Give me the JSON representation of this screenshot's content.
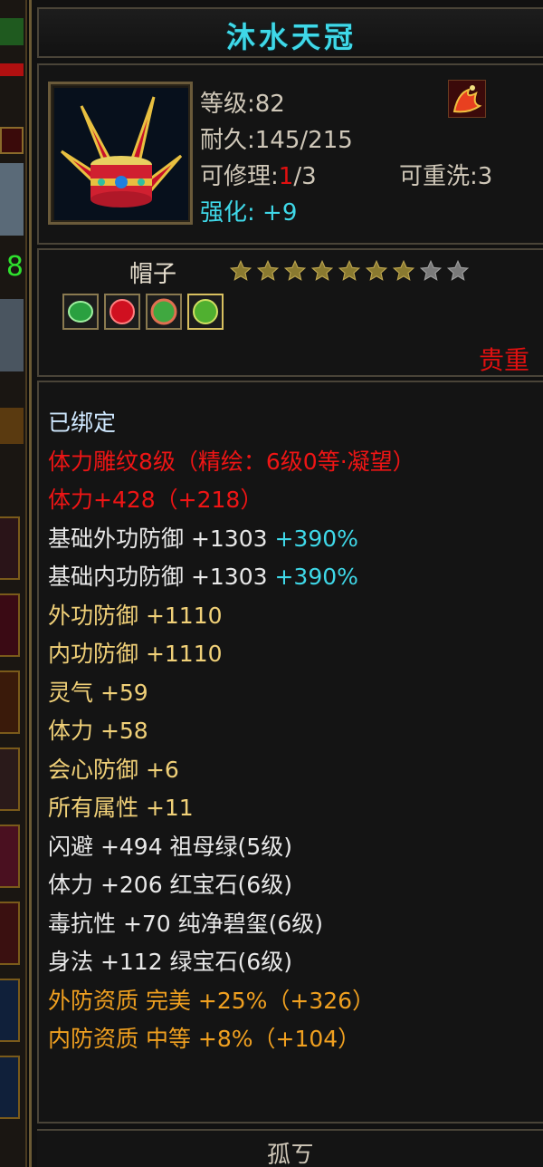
{
  "item": {
    "name": "沐水天冠",
    "level_label": "等级:82",
    "durability_label": "耐久:145/215",
    "repair_prefix": "可修理:",
    "repair_used": "1",
    "repair_max": "/3",
    "rewash_label": "可重洗:3",
    "enhance_label": "强化:",
    "enhance_value": "+9",
    "type": "帽子",
    "stars_filled": 7,
    "stars_total": 9,
    "rarity": "贵重",
    "gems": [
      {
        "icon": "green-jade-gem-icon"
      },
      {
        "icon": "red-ruby-gem-icon"
      },
      {
        "icon": "emerald-gem-icon"
      },
      {
        "icon": "green-gem-icon"
      }
    ]
  },
  "stats": [
    {
      "text": "已绑定",
      "color": "white"
    },
    {
      "text": "体力雕纹8级（精绘：6级0等·凝望）",
      "color": "red"
    },
    {
      "text": "体力+428（+218）",
      "color": "red"
    },
    {
      "text": "基础外功防御 +1303",
      "extra": " +390%",
      "color": "white"
    },
    {
      "text": "基础内功防御 +1303",
      "extra": " +390%",
      "color": "white"
    },
    {
      "text": "外功防御 +1110",
      "color": "yellow"
    },
    {
      "text": "内功防御 +1110",
      "color": "yellow"
    },
    {
      "text": "灵气 +59",
      "color": "yellow"
    },
    {
      "text": "体力 +58",
      "color": "yellow"
    },
    {
      "text": "会心防御 +6",
      "color": "yellow"
    },
    {
      "text": "所有属性 +11",
      "color": "yellow"
    },
    {
      "text": "闪避 +494 祖母绿(5级)",
      "color": "white"
    },
    {
      "text": "体力 +206 红宝石(6级)",
      "color": "white"
    },
    {
      "text": "毒抗性 +70 纯净碧玺(6级)",
      "color": "white"
    },
    {
      "text": "身法 +112 绿宝石(6级)",
      "color": "white"
    },
    {
      "text": "外防资质  完美 +25%（+326）",
      "color": "orange"
    },
    {
      "text": "内防资质  中等 +8%（+104）",
      "color": "orange"
    }
  ],
  "footer": {
    "text": "孤ㄎ"
  },
  "colors": {
    "title": "#3fd8e8",
    "enhance": "#3fd8e8",
    "rarity": "#e01010",
    "stat_white": "#e8e8e8",
    "stat_red": "#ee1515",
    "stat_yellow": "#f0d078",
    "stat_orange": "#f0a020",
    "stat_cyan": "#3fd8e8",
    "star_filled": "#8a7a30",
    "star_empty": "#7a7a7a"
  }
}
